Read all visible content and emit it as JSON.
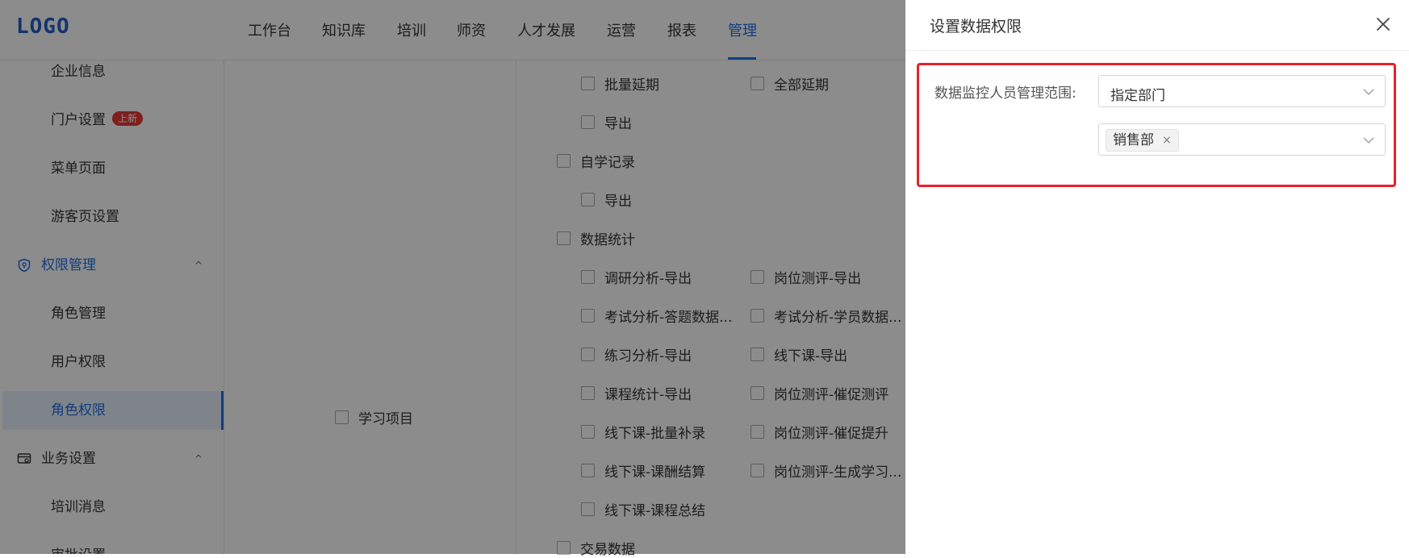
{
  "header": {
    "logo": "LOGO",
    "nav": [
      "工作台",
      "知识库",
      "培训",
      "师资",
      "人才发展",
      "运营",
      "报表",
      "管理"
    ],
    "active_nav": "管理"
  },
  "sidebar": {
    "items": [
      {
        "label": "企业信息"
      },
      {
        "label": "门户设置",
        "badge": "上新"
      },
      {
        "label": "菜单页面"
      },
      {
        "label": "游客页设置"
      }
    ],
    "group_permissions": {
      "label": "权限管理",
      "chevron": "^"
    },
    "permission_items": [
      "角色管理",
      "用户权限",
      "角色权限"
    ],
    "active_item": "角色权限",
    "group_business": {
      "label": "业务设置",
      "chevron": "^"
    },
    "business_items": [
      "培训消息",
      "审批设置"
    ]
  },
  "middle": {
    "checkbox_label": "学习项目"
  },
  "permissions": {
    "rows": [
      [
        "批量延期",
        "全部延期"
      ],
      [
        "导出"
      ],
      [
        "自学记录"
      ],
      [
        "导出"
      ],
      [
        "数据统计"
      ],
      [
        "调研分析-导出",
        "岗位测评-导出"
      ],
      [
        "考试分析-答题数据...",
        "考试分析-学员数据..."
      ],
      [
        "练习分析-导出",
        "线下课-导出"
      ],
      [
        "课程统计-导出",
        "岗位测评-催促测评"
      ],
      [
        "线下课-批量补录",
        "岗位测评-催促提升"
      ],
      [
        "线下课-课酬结算",
        "岗位测评-生成学习..."
      ],
      [
        "线下课-课程总结"
      ],
      [
        "交易数据"
      ]
    ]
  },
  "drawer": {
    "title": "设置数据权限",
    "close_icon": "close-icon",
    "field_label": "数据监控人员管理范围:",
    "scope_select": {
      "value": "指定部门"
    },
    "dept_select": {
      "tags": [
        "销售部"
      ],
      "remove_symbol": "×"
    }
  },
  "colors": {
    "accent": "#1f6fe5",
    "highlight_border": "#e8202a",
    "badge": "#e53935",
    "mask": "rgba(0,0,0,0.45)"
  }
}
